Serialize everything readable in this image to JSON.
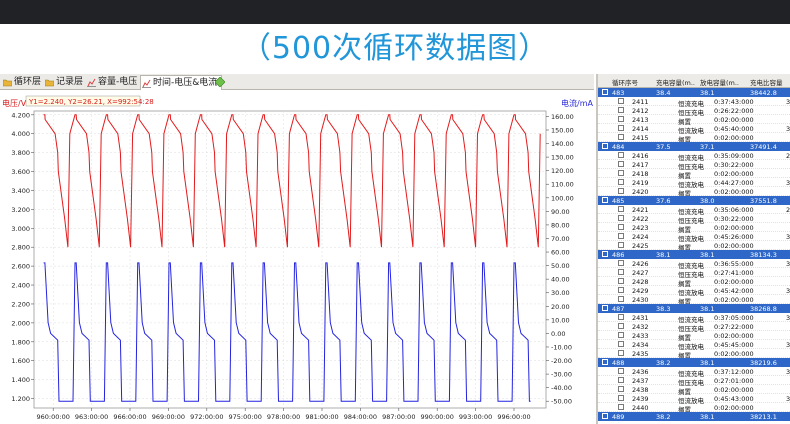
{
  "banner": {
    "title": "（500次循环数据图）"
  },
  "tabs": [
    {
      "label": "循环层",
      "icon": "folder-icon"
    },
    {
      "label": "记录层",
      "icon": "folder-icon"
    },
    {
      "label": "容量-电压",
      "icon": "chart-icon"
    },
    {
      "label": "时间-电压&电流",
      "icon": "chart-icon"
    }
  ],
  "cursor_readout": "Y1=2.240, Y2=26.21, X=992:54:28",
  "chart_data": {
    "type": "line",
    "xlabel": "",
    "ylabel_left": "电压/V",
    "ylabel_right": "电流/mA",
    "xlim": [
      958.5,
      998.5
    ],
    "x_ticks": [
      960,
      963,
      966,
      969,
      972,
      975,
      978,
      981,
      984,
      987,
      990,
      993,
      996
    ],
    "x_tick_labels": [
      "960:00:00",
      "963:00:00",
      "966:00:00",
      "969:00:00",
      "972:00:00",
      "975:00:00",
      "978:00:00",
      "981:00:00",
      "984:00:00",
      "987:00:00",
      "990:00:00",
      "993:00:00",
      "996:00:00"
    ],
    "ylim_left": [
      1.1,
      4.24
    ],
    "y_left_ticks": [
      "4.200",
      "4.000",
      "3.800",
      "3.600",
      "3.400",
      "3.200",
      "3.000",
      "2.800",
      "2.600",
      "2.400",
      "2.200",
      "2.000",
      "1.800",
      "1.600",
      "1.400",
      "1.200"
    ],
    "ylim_right": [
      -55,
      164
    ],
    "y_right_ticks": [
      "160.00",
      "150.00",
      "140.00",
      "130.00",
      "120.00",
      "110.00",
      "100.00",
      "90.00",
      "80.00",
      "70.00",
      "60.00",
      "50.00",
      "40.00",
      "30.00",
      "20.00",
      "10.00",
      "0.00",
      "-10.00",
      "-20.00",
      "-30.00",
      "-40.00",
      "-50.00"
    ],
    "cycle_period_hours": 2.45,
    "first_cycle_start_hour": 959.25,
    "cycles_shown": 16,
    "series": [
      {
        "axis": "left",
        "color": "#e31a1c",
        "profile_hours": [
          0,
          0.1,
          0.12,
          0.9,
          1.1,
          1.15,
          1.65,
          1.9,
          2.05,
          2.45
        ],
        "profile_values": [
          4.2,
          4.2,
          4.15,
          4.0,
          3.8,
          3.6,
          3.1,
          2.8,
          4.0,
          4.2
        ]
      },
      {
        "axis": "right",
        "color": "#2323e0",
        "profile_hours": [
          0,
          0.1,
          0.35,
          0.55,
          1.1,
          1.2,
          1.3,
          2.3,
          2.45
        ],
        "profile_values": [
          52,
          52,
          8,
          0,
          -5,
          -50,
          -50,
          -50,
          52
        ]
      }
    ]
  },
  "table": {
    "headers": [
      "循环序号",
      "充电容量(m..",
      "放电容量(m..",
      "充电比容量"
    ],
    "groups": [
      {
        "values": [
          "483",
          "38.4",
          "38.1",
          "38442.8"
        ],
        "rows": [
          [
            "2411",
            "恒流充电",
            "0:37:43:000",
            "3"
          ],
          [
            "2412",
            "恒压充电",
            "0:26:22:000",
            ""
          ],
          [
            "2413",
            "搁置",
            "0:02:00:000",
            ""
          ],
          [
            "2414",
            "恒流放电",
            "0:45:40:000",
            "3"
          ],
          [
            "2415",
            "搁置",
            "0:02:00:000",
            ""
          ]
        ]
      },
      {
        "values": [
          "484",
          "37.5",
          "37.1",
          "37491.4"
        ],
        "rows": [
          [
            "2416",
            "恒流充电",
            "0:35:09:000",
            "2"
          ],
          [
            "2417",
            "恒压充电",
            "0:30:22:000",
            ""
          ],
          [
            "2418",
            "搁置",
            "0:02:00:000",
            ""
          ],
          [
            "2419",
            "恒流放电",
            "0:44:27:000",
            "3"
          ],
          [
            "2420",
            "搁置",
            "0:02:00:000",
            ""
          ]
        ]
      },
      {
        "values": [
          "485",
          "37.6",
          "38.0",
          "37551.8"
        ],
        "rows": [
          [
            "2421",
            "恒流充电",
            "0:35:06:000",
            "2"
          ],
          [
            "2422",
            "恒压充电",
            "0:30:22:000",
            ""
          ],
          [
            "2423",
            "搁置",
            "0:02:00:000",
            ""
          ],
          [
            "2424",
            "恒流放电",
            "0:45:26:000",
            "3"
          ],
          [
            "2425",
            "搁置",
            "0:02:00:000",
            ""
          ]
        ]
      },
      {
        "values": [
          "486",
          "38.1",
          "38.1",
          "38134.3"
        ],
        "rows": [
          [
            "2426",
            "恒流充电",
            "0:36:55:000",
            "3"
          ],
          [
            "2427",
            "恒压充电",
            "0:27:41:000",
            ""
          ],
          [
            "2428",
            "搁置",
            "0:02:00:000",
            ""
          ],
          [
            "2429",
            "恒流放电",
            "0:45:42:000",
            "3"
          ],
          [
            "2430",
            "搁置",
            "0:02:00:000",
            ""
          ]
        ]
      },
      {
        "values": [
          "487",
          "38.3",
          "38.1",
          "38268.8"
        ],
        "rows": [
          [
            "2431",
            "恒流充电",
            "0:37:05:000",
            "3"
          ],
          [
            "2432",
            "恒压充电",
            "0:27:22:000",
            ""
          ],
          [
            "2433",
            "搁置",
            "0:02:00:000",
            ""
          ],
          [
            "2434",
            "恒流放电",
            "0:45:45:000",
            "3"
          ],
          [
            "2435",
            "搁置",
            "0:02:00:000",
            ""
          ]
        ]
      },
      {
        "values": [
          "488",
          "38.2",
          "38.1",
          "38219.6"
        ],
        "rows": [
          [
            "2436",
            "恒流充电",
            "0:37:12:000",
            "3"
          ],
          [
            "2437",
            "恒压充电",
            "0:27:01:000",
            ""
          ],
          [
            "2438",
            "搁置",
            "0:02:00:000",
            ""
          ],
          [
            "2439",
            "恒流放电",
            "0:45:43:000",
            "3"
          ],
          [
            "2440",
            "搁置",
            "0:02:00:000",
            ""
          ]
        ]
      },
      {
        "values": [
          "489",
          "38.2",
          "38.1",
          "38213.1"
        ],
        "rows": []
      }
    ]
  }
}
